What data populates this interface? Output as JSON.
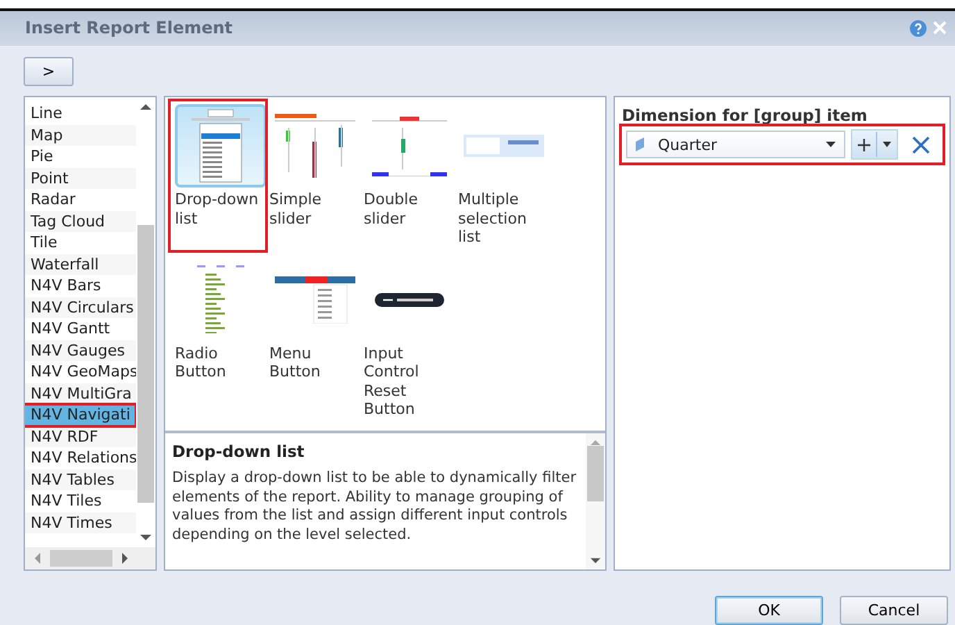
{
  "window": {
    "title": "Insert Report Element"
  },
  "expand_button": {
    "label": ">"
  },
  "element_types": [
    {
      "label": "Line",
      "selected": false,
      "highlighted": false
    },
    {
      "label": "Map",
      "selected": false,
      "highlighted": false
    },
    {
      "label": "Pie",
      "selected": false,
      "highlighted": false
    },
    {
      "label": "Point",
      "selected": false,
      "highlighted": false
    },
    {
      "label": "Radar",
      "selected": false,
      "highlighted": false
    },
    {
      "label": "Tag Cloud",
      "selected": false,
      "highlighted": false
    },
    {
      "label": "Tile",
      "selected": false,
      "highlighted": false
    },
    {
      "label": "Waterfall",
      "selected": false,
      "highlighted": false
    },
    {
      "label": "N4V Bars",
      "selected": false,
      "highlighted": false
    },
    {
      "label": "N4V Circulars",
      "selected": false,
      "highlighted": false
    },
    {
      "label": "N4V Gantt",
      "selected": false,
      "highlighted": false
    },
    {
      "label": "N4V Gauges",
      "selected": false,
      "highlighted": false
    },
    {
      "label": "N4V GeoMaps",
      "selected": false,
      "highlighted": false
    },
    {
      "label": "N4V MultiGra",
      "selected": false,
      "highlighted": false
    },
    {
      "label": "N4V Navigati",
      "selected": true,
      "highlighted": true
    },
    {
      "label": "N4V RDF",
      "selected": false,
      "highlighted": false
    },
    {
      "label": "N4V Relations",
      "selected": false,
      "highlighted": false
    },
    {
      "label": "N4V Tables",
      "selected": false,
      "highlighted": false
    },
    {
      "label": "N4V Tiles",
      "selected": false,
      "highlighted": false
    },
    {
      "label": "N4V Times",
      "selected": false,
      "highlighted": false
    }
  ],
  "gallery": [
    {
      "kind": "dropdown",
      "label": "Drop-down list",
      "selected": true,
      "highlighted": true
    },
    {
      "kind": "slider",
      "label": "Simple slider",
      "selected": false,
      "highlighted": false
    },
    {
      "kind": "double",
      "label": "Double slider",
      "selected": false,
      "highlighted": false
    },
    {
      "kind": "multi",
      "label": "Multiple selection list",
      "selected": false,
      "highlighted": false
    },
    {
      "kind": "radio",
      "label": "Radio Button",
      "selected": false,
      "highlighted": false
    },
    {
      "kind": "menu",
      "label": "Menu Button",
      "selected": false,
      "highlighted": false
    },
    {
      "kind": "reset",
      "label": "Input Control Reset Button",
      "selected": false,
      "highlighted": false
    }
  ],
  "description": {
    "title": "Drop-down list",
    "text": "Display a drop-down list to be able to dynamically filter elements of the report. Ability to manage grouping of values from the list and assign different input controls depending on the level selected."
  },
  "dimension": {
    "label": "Dimension for [group] item",
    "value": "Quarter",
    "highlighted": true
  },
  "buttons": [
    "OK",
    "Cancel"
  ]
}
